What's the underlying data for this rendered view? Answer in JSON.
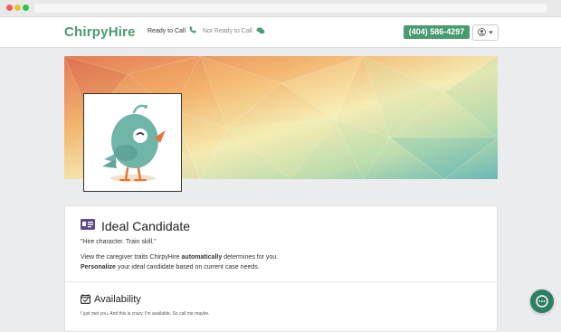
{
  "window": {
    "traffic_lights": [
      "#ee5e57",
      "#f5bd2f",
      "#2ac840"
    ]
  },
  "nav": {
    "logo": "ChirpyHire",
    "ready_label": "Ready to Call",
    "not_ready_label": "Not Ready to Call",
    "phone": "(404) 586-4297",
    "user_menu_icon": "user-circle-icon"
  },
  "profile": {
    "banner": "low-poly-gradient-banner",
    "avatar": "bird-logo"
  },
  "ideal_candidate": {
    "title": "Ideal Candidate",
    "quote": "\"Hire character. Train skill.\"",
    "line1_pre": "View the caregiver traits ChirpyHire ",
    "line1_bold": "automatically",
    "line1_post": " determines for you.",
    "line2_bold": "Personalize",
    "line2_post": " your ideal candidate based on current case needs."
  },
  "availability": {
    "title": "Availability",
    "description": "I just met you. And this is crazy. I'm available. So call me maybe."
  },
  "colors": {
    "brand_green": "#4a9a72",
    "chat_button": "#2f7d63",
    "accent_purple": "#5c4a8f"
  }
}
